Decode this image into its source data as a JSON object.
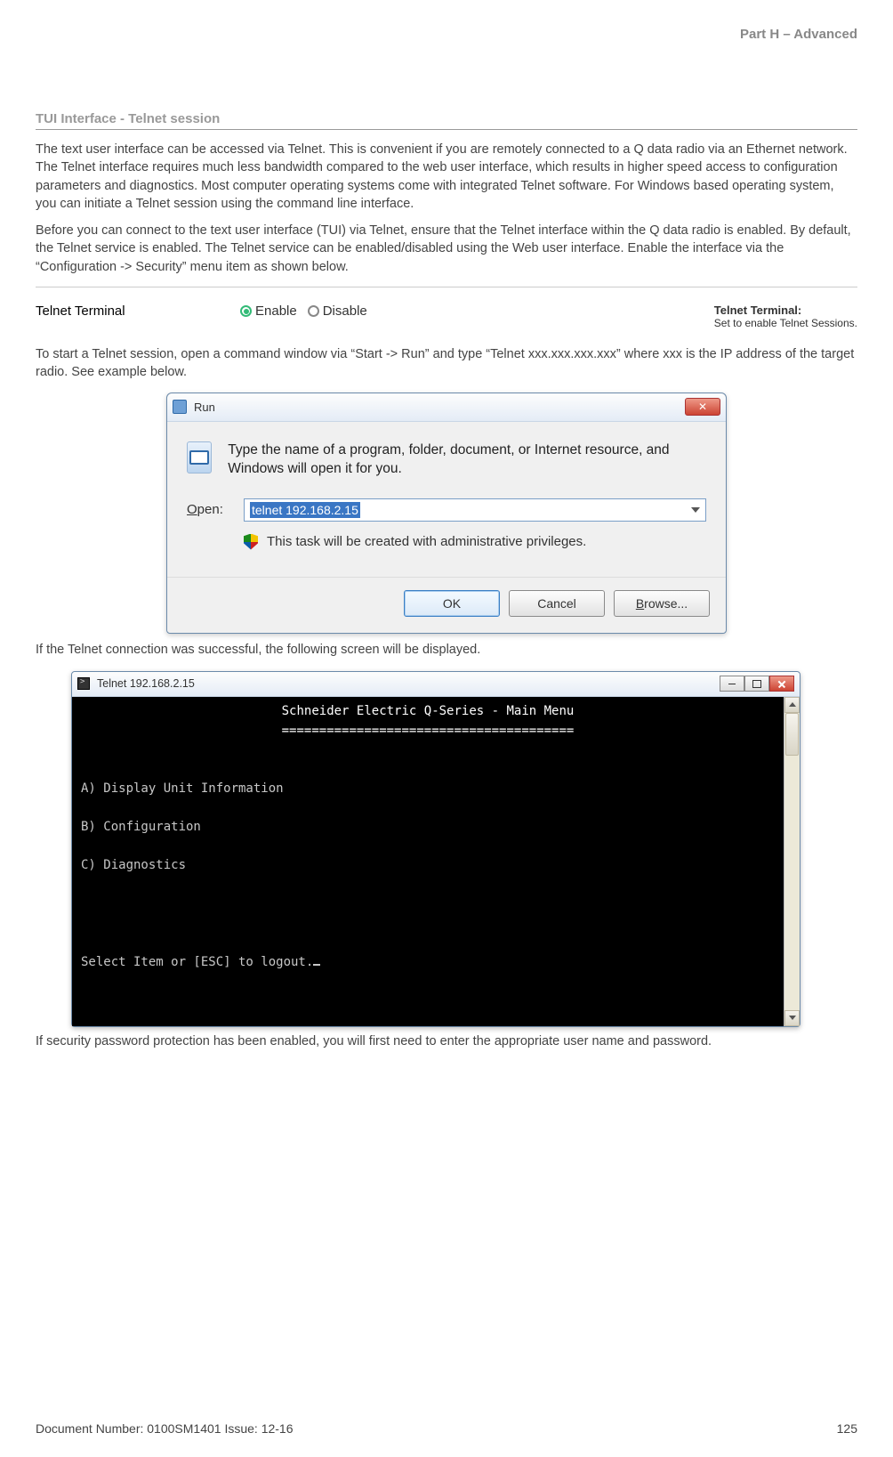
{
  "header": {
    "part": "Part H – Advanced"
  },
  "section": {
    "title": "TUI Interface - Telnet session"
  },
  "paras": {
    "p1": "The text user interface can be accessed via Telnet. This is convenient if you are remotely connected to a Q data radio via an Ethernet network. The Telnet interface requires much less bandwidth compared to the web user interface, which results in higher speed access to configuration parameters and diagnostics. Most computer operating systems come with integrated Telnet software. For Windows based operating system, you can initiate a Telnet session using the command line interface.",
    "p2": "Before you can connect to the text user interface (TUI) via Telnet, ensure that the Telnet interface within the Q data radio is enabled. By default, the Telnet service is enabled. The Telnet service can be enabled/disabled using the Web user interface. Enable the interface via the “Configuration -> Security” menu item as shown below.",
    "p3": "To start a Telnet session, open a command window via “Start -> Run”  and type “Telnet xxx.xxx.xxx.xxx” where xxx is the IP address of the target radio. See example below.",
    "p4": "If the Telnet connection was successful, the following screen will be displayed.",
    "p5": "If security password protection has been enabled, you will first need to enter the appropriate user name and password."
  },
  "telnet_config": {
    "label": "Telnet Terminal",
    "enable": "Enable",
    "disable": "Disable",
    "right_title": "Telnet Terminal:",
    "right_sub": "Set to enable Telnet Sessions."
  },
  "run": {
    "title": "Run",
    "desc": "Type the name of a program, folder, document, or Internet resource, and Windows will open it for you.",
    "open_label_u": "O",
    "open_label_rest": "pen:",
    "input_value": "telnet 192.168.2.15",
    "admin_note": "This task will be created with administrative privileges.",
    "ok": "OK",
    "cancel": "Cancel",
    "browse_u": "B",
    "browse_rest": "rowse..."
  },
  "term": {
    "title": "Telnet 192.168.2.15",
    "header": "Schneider Electric Q-Series - Main Menu",
    "divider": "=======================================",
    "a": "A) Display Unit Information",
    "b": "B) Configuration",
    "c": "C) Diagnostics",
    "prompt": "Select Item or [ESC] to logout."
  },
  "footer": {
    "left": "Document Number: 0100SM1401   Issue: 12-16",
    "right": "125"
  }
}
